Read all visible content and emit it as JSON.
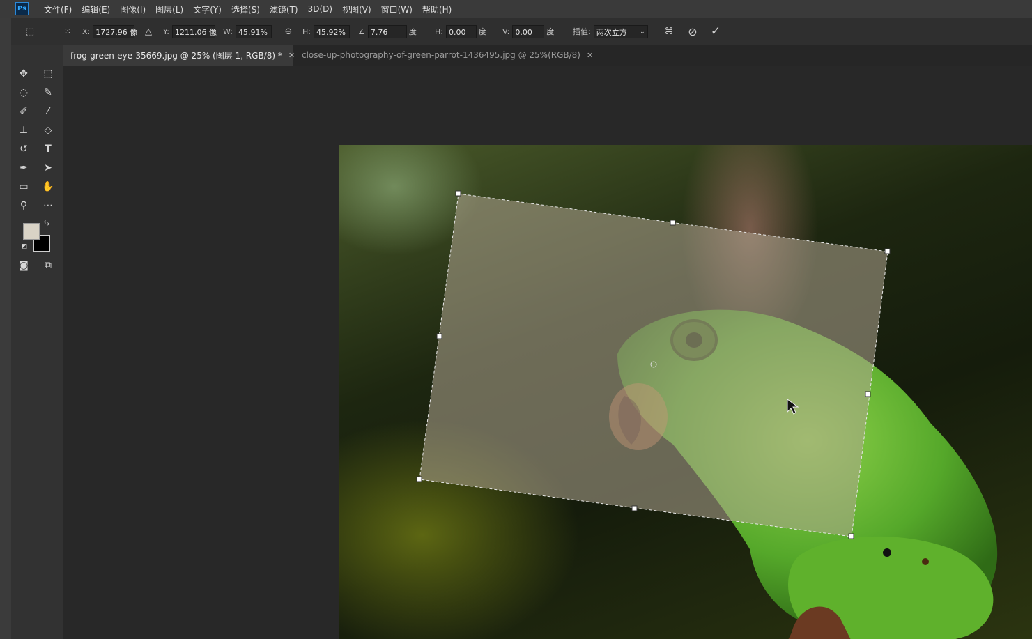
{
  "app": {
    "logo_text": "Ps"
  },
  "menu": [
    "文件(F)",
    "编辑(E)",
    "图像(I)",
    "图层(L)",
    "文字(Y)",
    "选择(S)",
    "滤镜(T)",
    "3D(D)",
    "视图(V)",
    "窗口(W)",
    "帮助(H)"
  ],
  "options": {
    "x_label": "X:",
    "x_value": "1727.96 像",
    "y_label": "Y:",
    "y_value": "1211.06 像",
    "w_label": "W:",
    "w_value": "45.91%",
    "h_label": "H:",
    "h_value": "45.92%",
    "rotate_value": "7.76",
    "rotate_unit": "度",
    "hskew_label": "H:",
    "hskew_value": "0.00",
    "hskew_unit": "度",
    "vskew_label": "V:",
    "vskew_value": "0.00",
    "vskew_unit": "度",
    "interp_label": "插值:",
    "interp_value": "两次立方"
  },
  "tabs": [
    {
      "label": "frog-green-eye-35669.jpg @ 25% (图层 1, RGB/8) *",
      "active": true
    },
    {
      "label": "close-up-photography-of-green-parrot-1436495.jpg @ 25%(RGB/8)",
      "active": false
    }
  ],
  "colors": {
    "foreground": "#d9d3c6",
    "background": "#000000",
    "accent": "#31a8ff"
  },
  "icons": [
    "move-tool-icon",
    "marquee-tool-icon",
    "lasso-tool-icon",
    "quick-select-tool-icon",
    "healing-brush-icon",
    "brush-tool-icon",
    "stamp-tool-icon",
    "eraser-tool-icon",
    "history-brush-icon",
    "type-tool-icon",
    "pen-tool-icon",
    "path-select-icon",
    "rectangle-tool-icon",
    "hand-tool-icon",
    "zoom-tool-icon",
    "more-tools-icon",
    "swap-colors-icon",
    "default-colors-icon",
    "quick-mask-icon",
    "screen-mode-icon",
    "link-icon",
    "warp-icon",
    "cancel-icon",
    "commit-icon"
  ]
}
